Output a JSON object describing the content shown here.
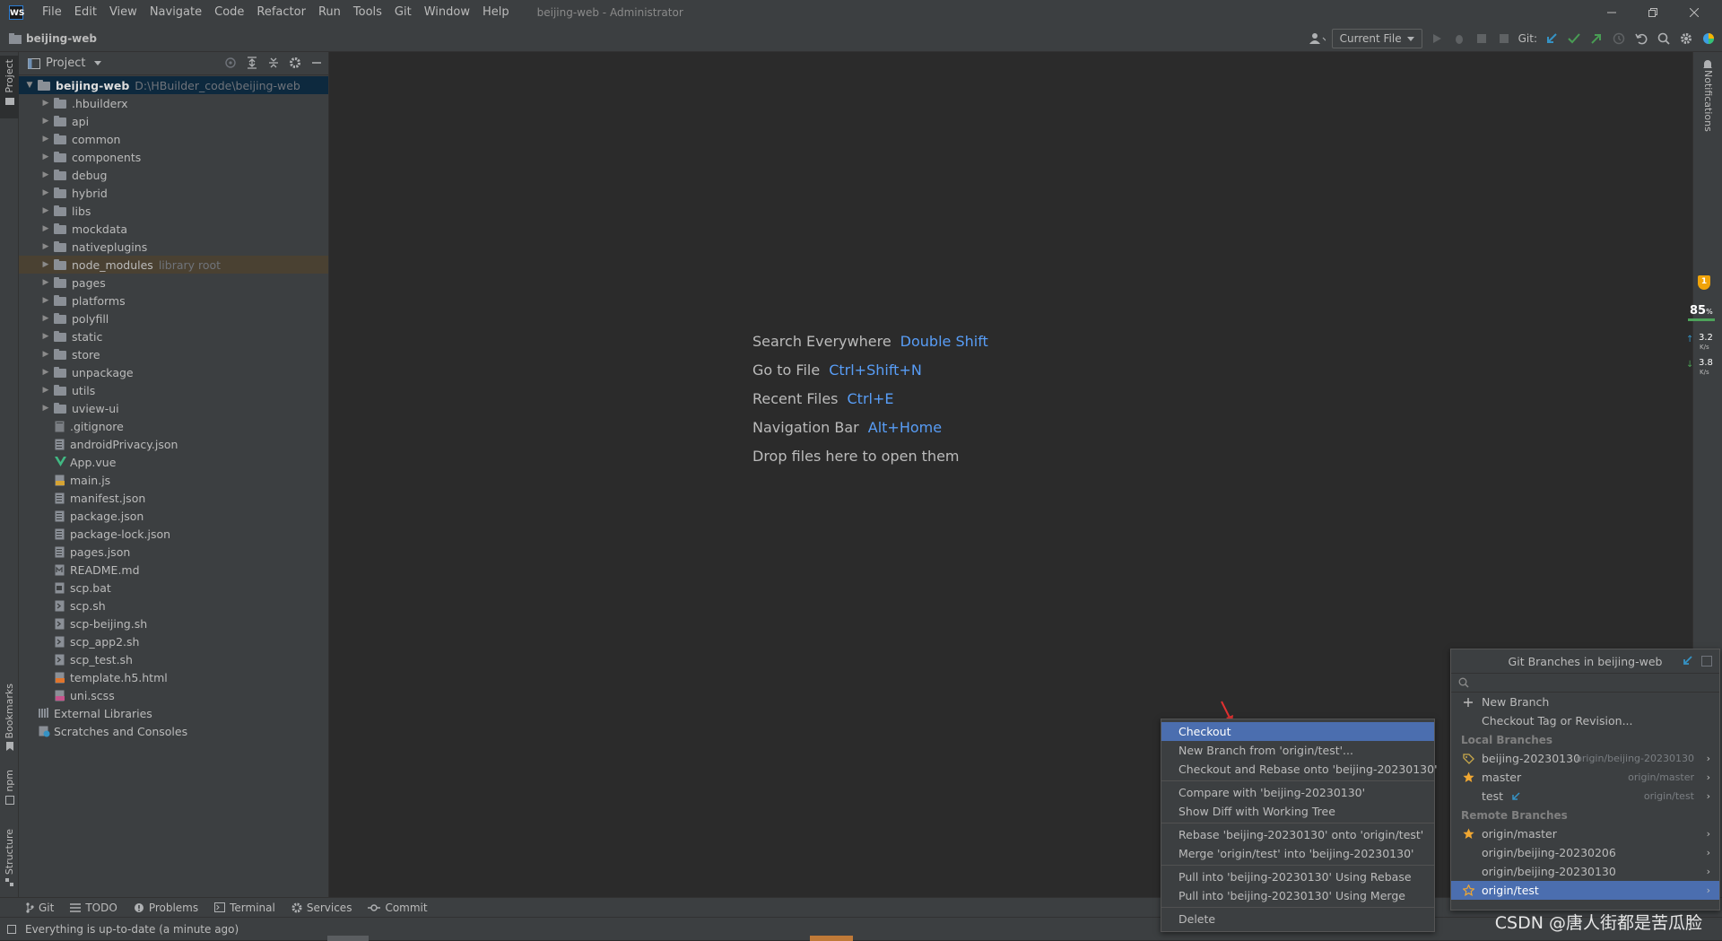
{
  "titlebar": {
    "logo": "WS",
    "menu": [
      "File",
      "Edit",
      "View",
      "Navigate",
      "Code",
      "Refactor",
      "Run",
      "Tools",
      "Git",
      "Window",
      "Help"
    ],
    "window_title": "beijing-web - Administrator",
    "controls": [
      "minimize-icon",
      "maximize-icon",
      "close-icon"
    ]
  },
  "navbar": {
    "project": "beijing-web",
    "run_config": "Current File",
    "git_label": "Git:"
  },
  "left_strip": {
    "project": "Project",
    "bookmarks": "Bookmarks",
    "npm": "npm",
    "structure": "Structure"
  },
  "project_panel": {
    "title": "Project",
    "root": {
      "name": "beijing-web",
      "path": "D:\\HBuilder_code\\beijing-web"
    },
    "folders": [
      ".hbuilderx",
      "api",
      "common",
      "components",
      "debug",
      "hybrid",
      "libs",
      "mockdata",
      "nativeplugins",
      "node_modules",
      "pages",
      "platforms",
      "polyfill",
      "static",
      "store",
      "unpackage",
      "utils",
      "uview-ui"
    ],
    "library_root_note": "library root",
    "files": [
      {
        "name": ".gitignore",
        "icon": "gitignore-icon"
      },
      {
        "name": "androidPrivacy.json",
        "icon": "json-icon"
      },
      {
        "name": "App.vue",
        "icon": "vue-icon"
      },
      {
        "name": "main.js",
        "icon": "js-icon"
      },
      {
        "name": "manifest.json",
        "icon": "json-icon"
      },
      {
        "name": "package.json",
        "icon": "json-icon"
      },
      {
        "name": "package-lock.json",
        "icon": "json-icon"
      },
      {
        "name": "pages.json",
        "icon": "json-icon"
      },
      {
        "name": "README.md",
        "icon": "markdown-icon"
      },
      {
        "name": "scp.bat",
        "icon": "script-icon"
      },
      {
        "name": "scp.sh",
        "icon": "shell-icon"
      },
      {
        "name": "scp-beijing.sh",
        "icon": "shell-icon"
      },
      {
        "name": "scp_app2.sh",
        "icon": "shell-icon"
      },
      {
        "name": "scp_test.sh",
        "icon": "shell-icon"
      },
      {
        "name": "template.h5.html",
        "icon": "html-icon"
      },
      {
        "name": "uni.scss",
        "icon": "scss-icon"
      }
    ],
    "extra": [
      "External Libraries",
      "Scratches and Consoles"
    ]
  },
  "welcome": [
    {
      "label": "Search Everywhere",
      "key": "Double Shift"
    },
    {
      "label": "Go to File",
      "key": "Ctrl+Shift+N"
    },
    {
      "label": "Recent Files",
      "key": "Ctrl+E"
    },
    {
      "label": "Navigation Bar",
      "key": "Alt+Home"
    },
    {
      "label": "Drop files here to open them",
      "key": ""
    }
  ],
  "right_strip": {
    "notifications": "Notifications",
    "monitor": {
      "badge": "1",
      "percent": "85",
      "percent_sign": "%",
      "up": "3.2",
      "down": "3.8",
      "unit": "K/s"
    }
  },
  "bottom_tabs": [
    "Git",
    "TODO",
    "Problems",
    "Terminal",
    "Services",
    "Commit"
  ],
  "status": {
    "text": "Everything is up-to-date (a minute ago)"
  },
  "context_menu": {
    "groups": [
      [
        "Checkout",
        "New Branch from 'origin/test'...",
        "Checkout and Rebase onto 'beijing-20230130'"
      ],
      [
        "Compare with 'beijing-20230130'",
        "Show Diff with Working Tree"
      ],
      [
        "Rebase 'beijing-20230130' onto 'origin/test'",
        "Merge 'origin/test' into 'beijing-20230130'"
      ],
      [
        "Pull into 'beijing-20230130' Using Rebase",
        "Pull into 'beijing-20230130' Using Merge"
      ],
      [
        "Delete"
      ]
    ]
  },
  "branches": {
    "title": "Git Branches in beijing-web",
    "actions": [
      "New Branch",
      "Checkout Tag or Revision..."
    ],
    "local_label": "Local Branches",
    "local": [
      {
        "name": "beijing-20230130",
        "track": "origin/beijing-20230130",
        "icon": "tag-icon"
      },
      {
        "name": "master",
        "track": "origin/master",
        "icon": "star-icon"
      },
      {
        "name": "test",
        "track": "origin/test",
        "icon": "incoming-arrow-icon"
      }
    ],
    "remote_label": "Remote Branches",
    "remote": [
      {
        "name": "origin/master",
        "icon": "star-icon"
      },
      {
        "name": "origin/beijing-20230206",
        "icon": ""
      },
      {
        "name": "origin/beijing-20230130",
        "icon": ""
      },
      {
        "name": "origin/test",
        "icon": "star-outline-icon"
      }
    ]
  },
  "watermark": "CSDN @唐人街都是苦瓜脸",
  "colors": {
    "accent": "#4b6eaf",
    "link": "#589df6",
    "bg": "#2b2b2b",
    "panel": "#3c3f41"
  }
}
